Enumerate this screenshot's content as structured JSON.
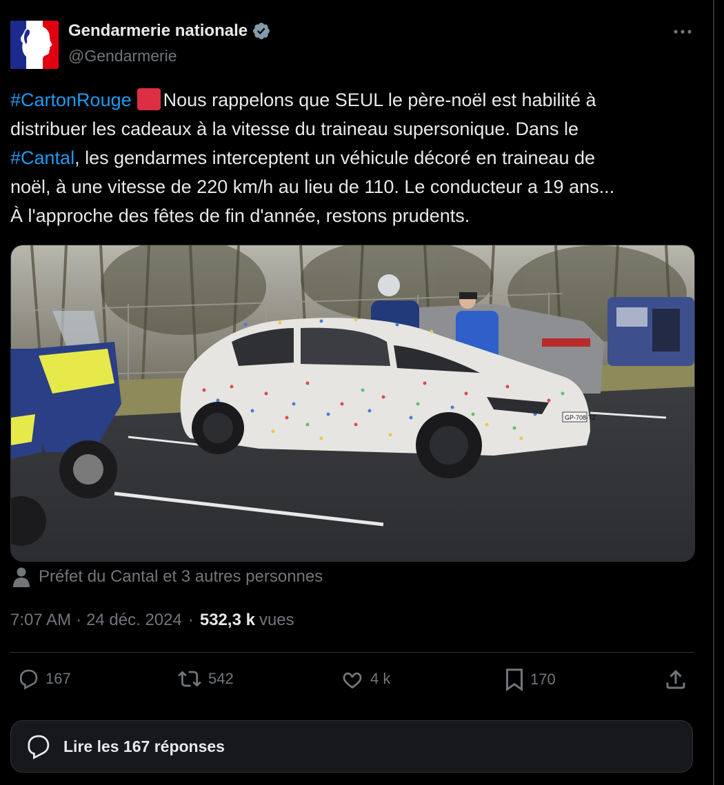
{
  "author": {
    "display_name": "Gendarmerie nationale",
    "handle": "@Gendarmerie",
    "avatar_icon": "marianne-logo-icon",
    "verified_icon": "verified-badge-icon"
  },
  "tweet": {
    "line1_hashtag": "#CartonRouge",
    "line1_emoji": "red-square-icon",
    "line1_text": "Nous rappelons que SEUL le père-noël est habilité à",
    "line2_text": "distribuer les cadeaux à la vitesse du traineau supersonique. Dans le",
    "line3_hashtag": "#Cantal",
    "line3_text": ", les gendarmes interceptent un véhicule décoré en traineau de",
    "line4_text": "noël, à une vitesse de 220 km/h au lieu de 110. Le conducteur a 19 ans...",
    "line5_text": "À l'approche des fêtes de fin d'année, restons prudents."
  },
  "media": {
    "description_icon": "photo-car-with-lights",
    "plate_text": "GP-708-TZ"
  },
  "tagged": {
    "icon": "person-icon",
    "text": "Préfet du Cantal et 3 autres personnes"
  },
  "meta": {
    "time": "7:07 AM",
    "dot1": "·",
    "date": "24 déc. 2024",
    "dot2": "·",
    "views_count": "532,3 k",
    "views_label": "vues"
  },
  "actions": {
    "reply_count": "167",
    "retweet_count": "542",
    "like_count": "4 k",
    "bookmark_count": "170"
  },
  "replies_button": {
    "label": "Lire les 167 réponses"
  },
  "colors": {
    "background": "#000000",
    "text": "#e7e9ea",
    "secondary": "#71767b",
    "link": "#1d9bf0",
    "border": "#2f3336"
  }
}
